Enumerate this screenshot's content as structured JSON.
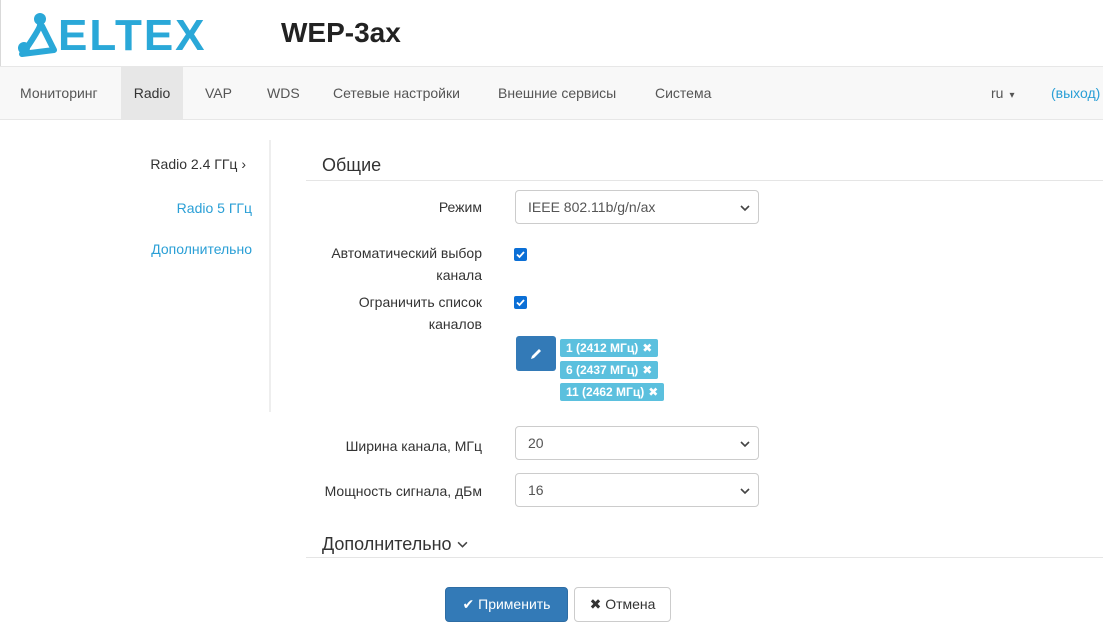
{
  "header": {
    "logo_text": "ELTEX",
    "product": "WEP-3ax",
    "brand_color": "#2aa8d8"
  },
  "nav": {
    "items": [
      {
        "label": "Мониторинг"
      },
      {
        "label": "Radio"
      },
      {
        "label": "VAP"
      },
      {
        "label": "WDS"
      },
      {
        "label": "Сетевые настройки"
      },
      {
        "label": "Внешние сервисы"
      },
      {
        "label": "Система"
      }
    ],
    "active": "Radio",
    "lang": "ru",
    "logout": "(выход)"
  },
  "sidebar": {
    "items": [
      {
        "label": "Radio 2.4 ГГц",
        "suffix": "›"
      },
      {
        "label": "Radio 5 ГГц"
      },
      {
        "label": "Дополнительно"
      }
    ]
  },
  "main": {
    "section_general": "Общие",
    "mode_label": "Режим",
    "mode_value": "IEEE 802.11b/g/n/ax",
    "auto_channel_label_1": "Автоматический выбор",
    "auto_channel_label_2": "канала",
    "auto_channel_checked": true,
    "limit_channels_label_1": "Ограничить список",
    "limit_channels_label_2": "каналов",
    "limit_channels_checked": true,
    "channels": [
      {
        "label": "1 (2412 МГц)"
      },
      {
        "label": "6 (2437 МГц)"
      },
      {
        "label": "11 (2462 МГц)"
      }
    ],
    "width_label": "Ширина канала, МГц",
    "width_value": "20",
    "power_label": "Мощность сигнала, дБм",
    "power_value": "16",
    "section_additional": "Дополнительно",
    "section_additional_chevron": "⌄",
    "apply_label": "Применить",
    "cancel_label": "Отмена"
  }
}
